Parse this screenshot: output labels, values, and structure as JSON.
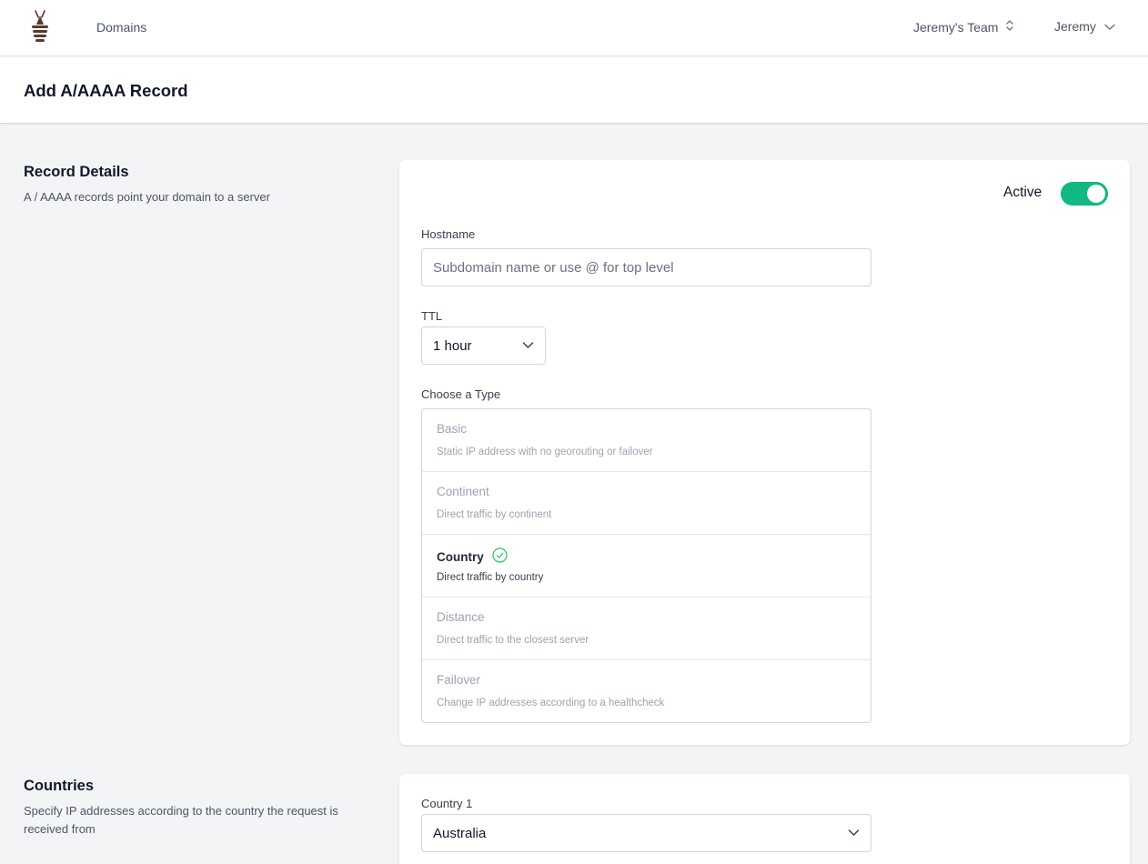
{
  "nav": {
    "domains_label": "Domains",
    "team_label": "Jeremy's Team",
    "user_label": "Jeremy"
  },
  "page": {
    "title": "Add A/AAAA Record"
  },
  "record_details": {
    "title": "Record Details",
    "description": "A / AAAA records point your domain to a server",
    "active_label": "Active",
    "active": true,
    "hostname_label": "Hostname",
    "hostname_value": "",
    "hostname_placeholder": "Subdomain name or use @ for top level",
    "ttl_label": "TTL",
    "ttl_value": "1 hour",
    "type_label": "Choose a Type",
    "types": [
      {
        "name": "Basic",
        "description": "Static IP address with no georouting or failover",
        "selected": false
      },
      {
        "name": "Continent",
        "description": "Direct traffic by continent",
        "selected": false
      },
      {
        "name": "Country",
        "description": "Direct traffic by country",
        "selected": true
      },
      {
        "name": "Distance",
        "description": "Direct traffic to the closest server",
        "selected": false
      },
      {
        "name": "Failover",
        "description": "Change IP addresses according to a healthcheck",
        "selected": false
      }
    ]
  },
  "countries": {
    "title": "Countries",
    "description": "Specify IP addresses according to the country the request is received from",
    "country1_label": "Country 1",
    "country1_value": "Australia"
  },
  "colors": {
    "accent": "#10b981",
    "logo": "#5b3a2e",
    "check": "#22c55e"
  },
  "icons": {
    "logo": "bee-logo-icon",
    "team_switch": "chevron-up-down-icon",
    "user_menu": "chevron-down-icon",
    "selected_type": "check-circle-icon"
  }
}
